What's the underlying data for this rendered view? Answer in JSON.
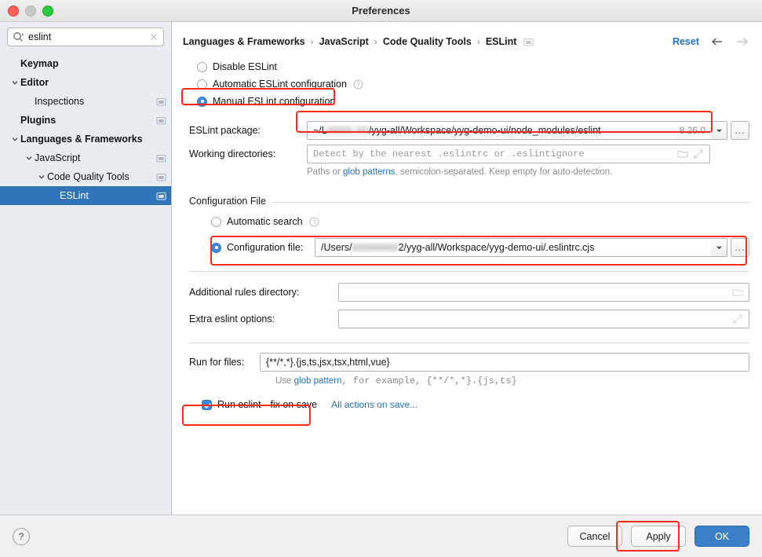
{
  "window": {
    "title": "Preferences",
    "traffic_lights": [
      "close",
      "minimize",
      "maximize"
    ]
  },
  "sidebar": {
    "search": {
      "value": "eslint",
      "placeholder": "",
      "icon": "search-icon",
      "clear_icon": "clear-icon"
    },
    "items": [
      {
        "label": "Keymap",
        "indent": 0,
        "bold": true,
        "twisty": "",
        "has_icon": false,
        "selected": false
      },
      {
        "label": "Editor",
        "indent": 0,
        "bold": true,
        "twisty": "down",
        "has_icon": false,
        "selected": false
      },
      {
        "label": "Inspections",
        "indent": 1,
        "bold": false,
        "twisty": "",
        "has_icon": true,
        "selected": false
      },
      {
        "label": "Plugins",
        "indent": 0,
        "bold": true,
        "twisty": "",
        "has_icon": true,
        "selected": false
      },
      {
        "label": "Languages & Frameworks",
        "indent": 0,
        "bold": true,
        "twisty": "down",
        "has_icon": false,
        "selected": false
      },
      {
        "label": "JavaScript",
        "indent": 1,
        "bold": false,
        "twisty": "down",
        "has_icon": true,
        "selected": false
      },
      {
        "label": "Code Quality Tools",
        "indent": 2,
        "bold": false,
        "twisty": "down",
        "has_icon": true,
        "selected": false
      },
      {
        "label": "ESLint",
        "indent": 3,
        "bold": false,
        "twisty": "",
        "has_icon": true,
        "selected": true
      }
    ]
  },
  "header": {
    "breadcrumbs": [
      "Languages & Frameworks",
      "JavaScript",
      "Code Quality Tools",
      "ESLint"
    ],
    "separator": "›",
    "trailing_icon": "settings-module-icon",
    "reset_label": "Reset",
    "back_icon": "arrow-left-icon",
    "forward_icon": "arrow-right-icon"
  },
  "main": {
    "mode_options": [
      {
        "label": "Disable ESLint",
        "selected": false,
        "help": false
      },
      {
        "label": "Automatic ESLint configuration",
        "selected": false,
        "help": true
      },
      {
        "label": "Manual ESLint configuration",
        "selected": true,
        "help": false
      }
    ],
    "eslint_package": {
      "label": "ESLint package:",
      "value_prefix": "~/L",
      "value_redacted": "iiiiiiiiii iiiii",
      "value_suffix": "/yyg-all/Workspace/yyg-demo-ui/node_modules/eslint",
      "version": "8.26.0",
      "dropdown_icon": "chevron-down-icon",
      "browse_label": "..."
    },
    "working_directories": {
      "label": "Working directories:",
      "value": "",
      "placeholder": "Detect by the nearest .eslintrc or .eslintignore",
      "folder_icon": "folder-icon",
      "expand_icon": "expand-icon",
      "hint_prefix": "Paths or ",
      "hint_link": "glob patterns",
      "hint_suffix": ", semicolon-separated. Keep empty for auto-detection."
    },
    "configuration_file": {
      "group_title": "Configuration File",
      "automatic_search": {
        "label": "Automatic search",
        "selected": false,
        "help": true
      },
      "config_file": {
        "label": "Configuration file:",
        "selected": true,
        "value_prefix": "/Users/",
        "value_redacted": "iiiiiiiiiiiiiiiiii",
        "value_suffix": "2/yyg-all/Workspace/yyg-demo-ui/.eslintrc.cjs",
        "dropdown_icon": "chevron-down-icon",
        "browse_label": "..."
      }
    },
    "additional_rules_directory": {
      "label": "Additional rules directory:",
      "value": "",
      "folder_icon": "folder-icon"
    },
    "extra_eslint_options": {
      "label": "Extra eslint options:",
      "value": "",
      "expand_icon": "expand-icon"
    },
    "run_for_files": {
      "label": "Run for files:",
      "value": "{**/*,*}.{js,ts,jsx,tsx,html,vue}",
      "hint_prefix": "Use ",
      "hint_link": "glob pattern",
      "hint_suffix": ", for example, {**/*,*}.{js,ts}"
    },
    "fix_on_save": {
      "label": "Run eslint --fix on save",
      "checked": true,
      "actions_link": "All actions on save..."
    }
  },
  "footer": {
    "help_label": "?",
    "cancel_label": "Cancel",
    "apply_label": "Apply",
    "ok_label": "OK"
  },
  "colors": {
    "accent_blue": "#3c8ae0",
    "selection_blue": "#2f73b8",
    "link_blue": "#2470c2",
    "highlight_red": "#ff2a13",
    "primary_button": "#3c7fc9"
  },
  "annotations": [
    {
      "name": "manual-config-highlight"
    },
    {
      "name": "eslint-package-highlight"
    },
    {
      "name": "config-file-highlight"
    },
    {
      "name": "fix-on-save-highlight"
    },
    {
      "name": "apply-button-highlight"
    }
  ]
}
